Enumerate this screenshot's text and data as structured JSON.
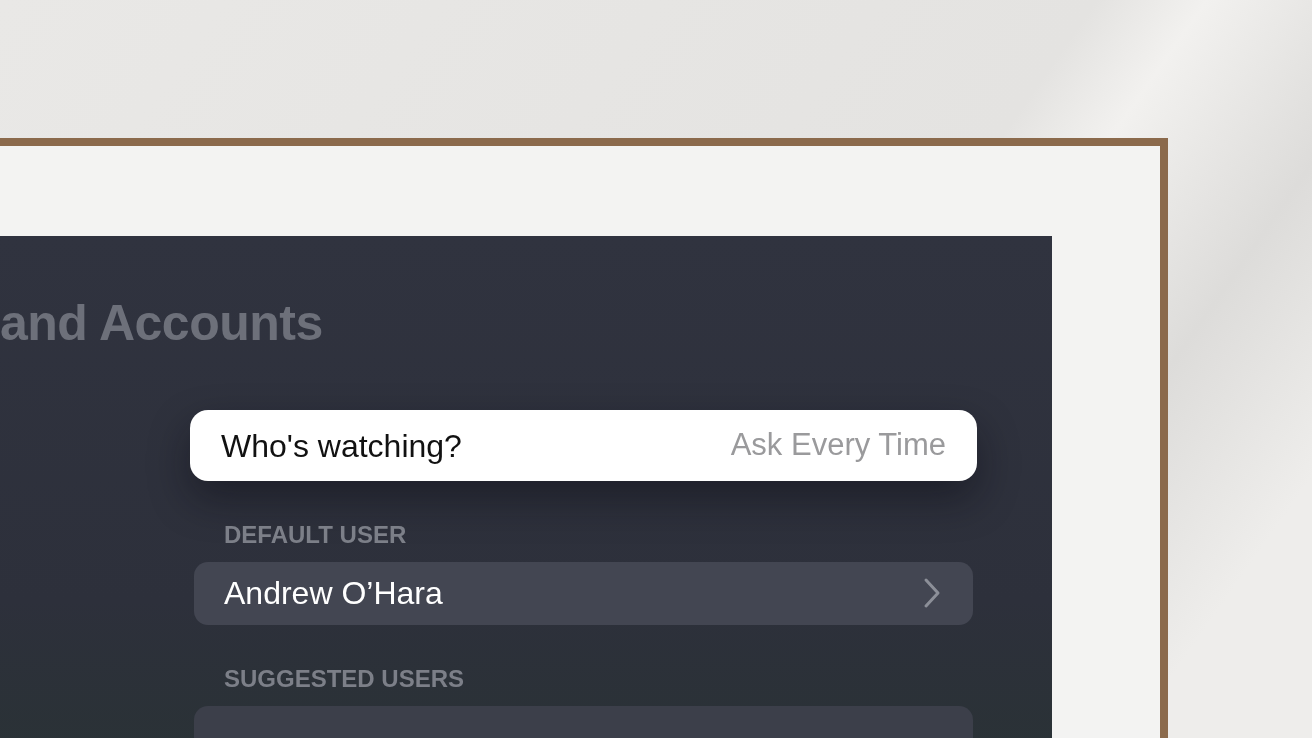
{
  "screen": {
    "title": "and Accounts",
    "focus_row": {
      "label": "Who's watching?",
      "value": "Ask Every Time",
      "selected": true
    },
    "sections": [
      {
        "header": "DEFAULT USER",
        "items": [
          {
            "label": "Andrew O’Hara",
            "kind": "link"
          }
        ]
      },
      {
        "header": "SUGGESTED USERS"
      }
    ]
  }
}
